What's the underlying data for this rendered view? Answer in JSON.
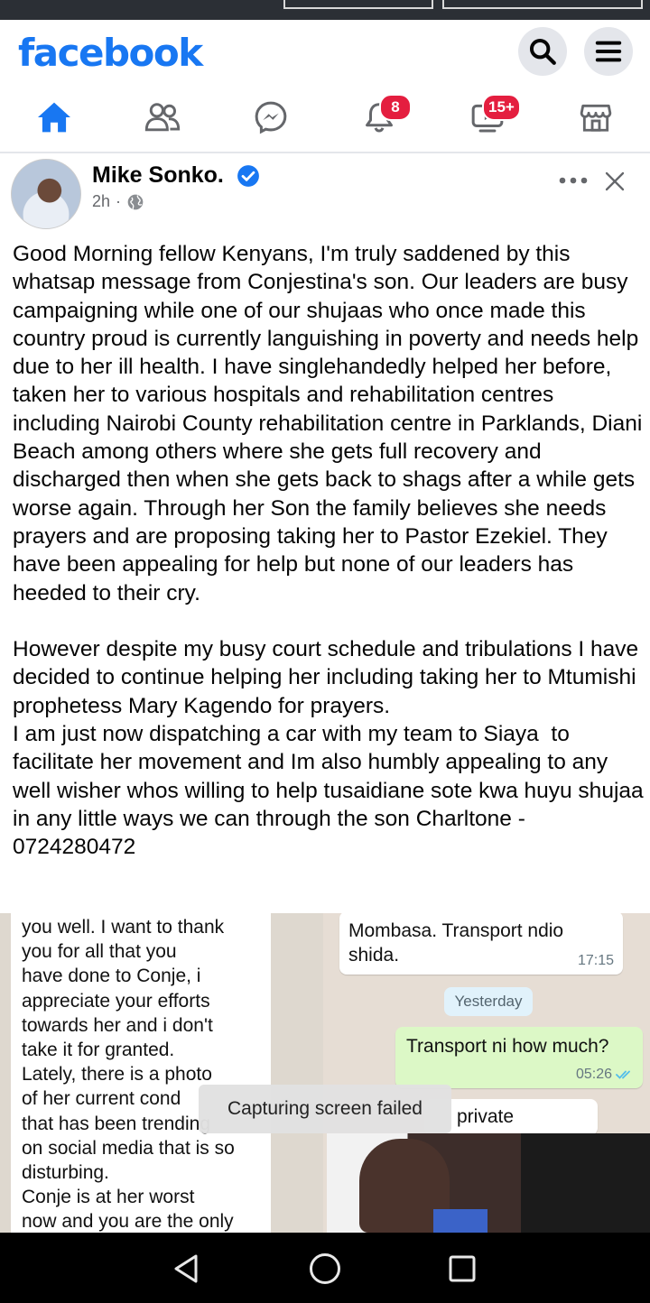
{
  "app": {
    "logo_text": "facebook"
  },
  "header": {
    "search_icon": "search-icon",
    "menu_icon": "hamburger-menu-icon"
  },
  "nav": {
    "items": [
      {
        "name": "home",
        "icon": "home-icon",
        "active": true
      },
      {
        "name": "friends",
        "icon": "friends-icon"
      },
      {
        "name": "messenger",
        "icon": "messenger-icon"
      },
      {
        "name": "notifications",
        "icon": "bell-icon",
        "badge": "8"
      },
      {
        "name": "watch",
        "icon": "video-icon",
        "badge": "15+"
      },
      {
        "name": "marketplace",
        "icon": "store-icon"
      }
    ]
  },
  "post": {
    "author": "Mike Sonko.",
    "time": "2h",
    "separator": "·",
    "privacy_icon": "globe-icon",
    "more_icon": "more-dots-icon",
    "close_icon": "close-icon",
    "body": "Good Morning fellow Kenyans, I'm truly saddened by this whatsap message from Conjestina's son. Our leaders are busy campaigning while one of our shujaas who once made this country proud is currently languishing in poverty and needs help due to her ill health. I have singlehandedly helped her before, taken her to various hospitals and rehabilitation centres including Nairobi County rehabilitation centre in Parklands, Diani Beach among others where she gets full recovery and discharged then when she gets back to shags after a while gets worse again. Through her Son the family believes she needs prayers and are proposing taking her to Pastor Ezekiel. They have been appealing for help but none of our leaders has heeded to their cry.\n\nHowever despite my busy court schedule and tribulations I have decided to continue helping her including taking her to Mtumishi prophetess Mary Kagendo for prayers.\nI am just now dispatching a car with my team to Siaya  to facilitate her movement and Im also humbly appealing to any well wisher whos willing to help tusaidiane sote kwa huyu shujaa in any little ways we can through the son Charltone - 0724280472"
  },
  "image": {
    "left_chat": "you well. I want to thank\nyou for all that you\nhave done to Conje, i\nappreciate your efforts\ntowards her and i don't\ntake it for granted.\nLately, there is a photo\nof her current cond\nthat has been trending\non social media that is so\ndisturbing.\nConje is at her worst\nnow and you are the only",
    "right_msg1": "Mombasa. Transport ndio\nshida.",
    "right_msg1_time": "17:15",
    "date_chip": "Yesterday",
    "right_msg2": "Transport ni how much?",
    "right_msg2_time": "05:26",
    "right_msg3": "private"
  },
  "toast": {
    "text": "Capturing screen failed"
  },
  "system_nav": {
    "back_icon": "back-triangle-icon",
    "home_icon": "home-circle-icon",
    "recents_icon": "recents-square-icon"
  },
  "colors": {
    "brand": "#1877f2",
    "badge": "#e41e3f",
    "text_secondary": "#65676b"
  }
}
